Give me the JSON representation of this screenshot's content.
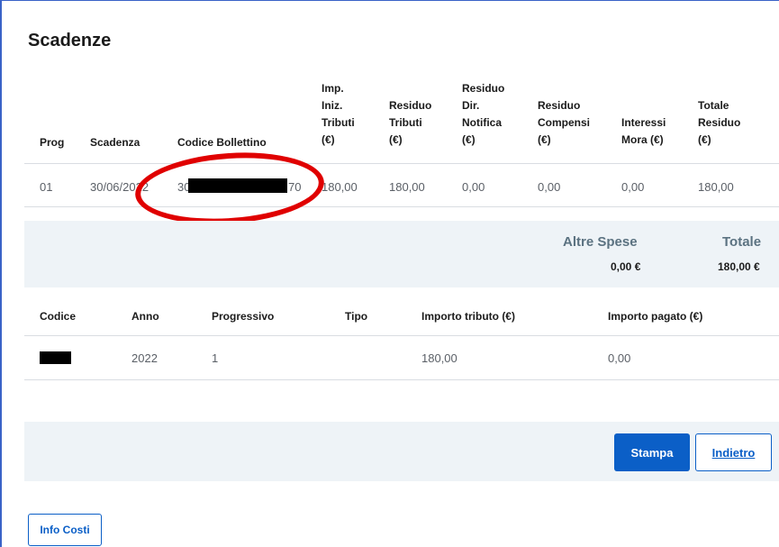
{
  "page": {
    "title": "Scadenze"
  },
  "scadenze_table": {
    "headers": {
      "prog": "Prog",
      "scadenza": "Scadenza",
      "codice": "Codice Bollettino",
      "imp_line1": "Imp.",
      "imp_line2": "Iniz.",
      "imp_line3": "Tributi",
      "imp_line4": "(€)",
      "res_trib_line1": "Residuo",
      "res_trib_line2": "Tributi",
      "res_trib_line3": "(€)",
      "res_dir_line1": "Residuo",
      "res_dir_line2": "Dir.",
      "res_dir_line3": "Notifica",
      "res_dir_line4": "(€)",
      "res_comp_line1": "Residuo",
      "res_comp_line2": "Compensi",
      "res_comp_line3": "(€)",
      "int_line1": "Interessi",
      "int_line2": "Mora (€)",
      "tot_line1": "Totale",
      "tot_line2": "Residuo",
      "tot_line3": "(€)"
    },
    "row": {
      "prog": "01",
      "scadenza": "30/06/2022",
      "codice_prefix": "30",
      "codice_suffix": "70",
      "imp": "180,00",
      "res_trib": "180,00",
      "res_dir": "0,00",
      "res_comp": "0,00",
      "interessi": "0,00",
      "totale": "180,00"
    }
  },
  "summary": {
    "altre_spese_label": "Altre Spese",
    "altre_spese_value": "0,00 €",
    "totale_label": "Totale",
    "totale_value": "180,00 €"
  },
  "tributi_table": {
    "headers": {
      "codice": "Codice",
      "anno": "Anno",
      "progressivo": "Progressivo",
      "tipo": "Tipo",
      "importo_tributo": "Importo tributo (€)",
      "importo_pagato": "Importo pagato (€)"
    },
    "row": {
      "codice": "",
      "anno": "2022",
      "progressivo": "1",
      "tipo": "",
      "importo_tributo": "180,00",
      "importo_pagato": "0,00"
    }
  },
  "actions": {
    "stampa": "Stampa",
    "indietro": "Indietro",
    "info_costi": "Info Costi"
  },
  "colors": {
    "primary": "#0b5fc7",
    "band": "#eef3f7",
    "annotation": "#e00000"
  }
}
